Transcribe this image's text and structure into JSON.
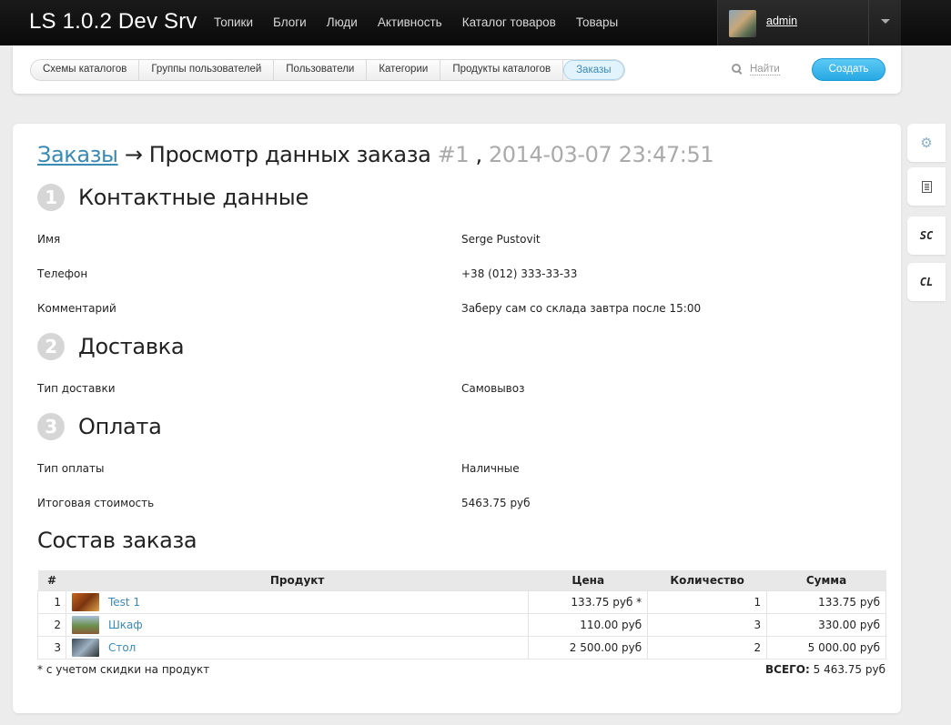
{
  "brand": "LS 1.0.2 Dev Srv",
  "nav": [
    "Топики",
    "Блоги",
    "Люди",
    "Активность",
    "Каталог товаров",
    "Товары"
  ],
  "user": {
    "name": "admin"
  },
  "subnav": {
    "tabs": [
      "Схемы каталогов",
      "Группы пользователей",
      "Пользователи",
      "Категории",
      "Продукты каталогов",
      "Заказы"
    ],
    "active_tab": "Заказы",
    "search_label": "Найти",
    "create_label": "Создать"
  },
  "heading": {
    "crumb": "Заказы",
    "arrow": "→",
    "title": "Просмотр данных заказа",
    "order_number": "#1",
    "comma": ",",
    "date": "2014-03-07 23:47:51"
  },
  "sections": {
    "contact": {
      "number": "1",
      "title": "Контактные данные",
      "rows": [
        {
          "label": "Имя",
          "value": "Serge Pustovit"
        },
        {
          "label": "Телефон",
          "value": "+38 (012) 333-33-33"
        },
        {
          "label": "Комментарий",
          "value": "Заберу сам со склада завтра после 15:00"
        }
      ]
    },
    "delivery": {
      "number": "2",
      "title": "Доставка",
      "rows": [
        {
          "label": "Тип доставки",
          "value": "Самовывоз"
        }
      ]
    },
    "payment": {
      "number": "3",
      "title": "Оплата",
      "rows": [
        {
          "label": "Тип оплаты",
          "value": "Наличные"
        },
        {
          "label": "Итоговая стоимость",
          "value": "5463.75 руб"
        }
      ]
    }
  },
  "order": {
    "title": "Состав заказа",
    "columns": [
      "#",
      "Продукт",
      "Цена",
      "Количество",
      "Сумма"
    ],
    "items": [
      {
        "idx": "1",
        "name": "Test 1",
        "price": "133.75 руб *",
        "qty": "1",
        "sum": "133.75 руб"
      },
      {
        "idx": "2",
        "name": "Шкаф",
        "price": "110.00 руб",
        "qty": "3",
        "sum": "330.00 руб"
      },
      {
        "idx": "3",
        "name": "Стол",
        "price": "2 500.00 руб",
        "qty": "2",
        "sum": "5 000.00 руб"
      }
    ],
    "footnote": "* с учетом скидки на продукт",
    "total_label": "ВСЕГО:",
    "total_value": "5 463.75 руб"
  },
  "side_toolbar": {
    "items": [
      "gear-icon",
      "document-icon",
      "SC",
      "CL"
    ]
  }
}
